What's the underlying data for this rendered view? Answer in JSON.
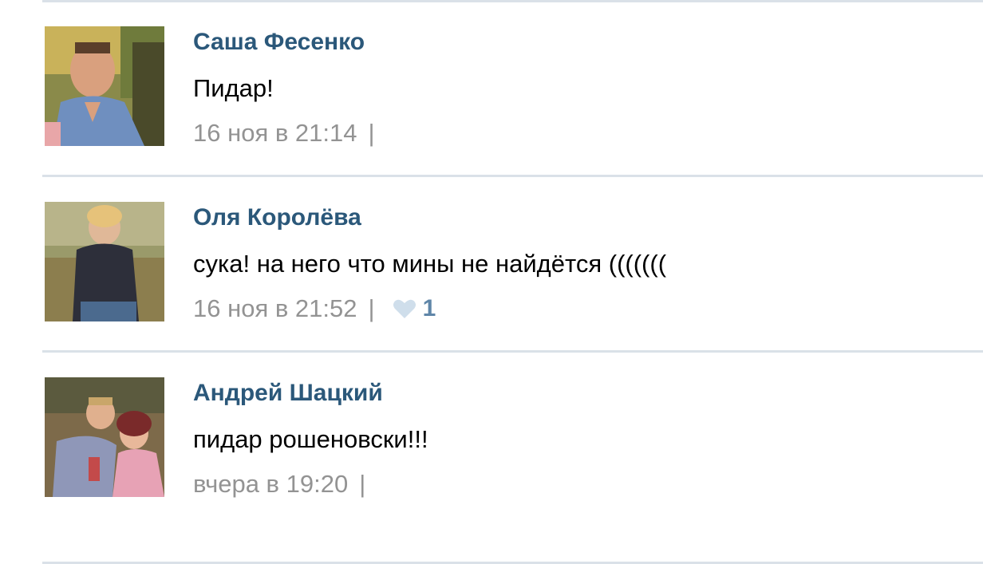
{
  "comments": [
    {
      "author": "Саша Фесенко",
      "text": "Пидар!",
      "date": "16 ноя в 21:14",
      "separator": "|"
    },
    {
      "author": "Оля Королёва",
      "text": "сука! на него что мины не найдётся (((((((",
      "date": "16 ноя в 21:52",
      "separator": "|",
      "like_icon": "heart-icon",
      "likes": "1"
    },
    {
      "author": "Андрей Шацкий",
      "text": "пидар рошеновски!!!",
      "date": "вчера в 19:20",
      "separator": "|"
    }
  ],
  "colors": {
    "author": "#2b587a",
    "meta": "#939393",
    "like_count": "#5f86a8",
    "heart": "#cfdeeb",
    "divider": "#dae1e8"
  }
}
